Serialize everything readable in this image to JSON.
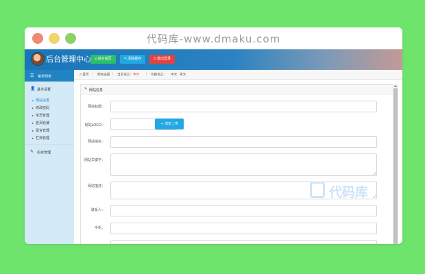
{
  "watermark_url": "代码库-www.dmaku.com",
  "header": {
    "title": "后台管理中心",
    "buttons": [
      {
        "icon": "home-icon",
        "label": "前台首页"
      },
      {
        "icon": "wrench-icon",
        "label": "清除缓存"
      },
      {
        "icon": "power-icon",
        "label": "退出登录"
      }
    ]
  },
  "sidebar": {
    "menu_title": "菜单列表",
    "groups": [
      {
        "label": "基本设置",
        "icon": "user-icon",
        "items": [
          "网站设置",
          "修改密码",
          "单页管理",
          "首页轮播",
          "留言管理",
          "栏目管理"
        ],
        "active_index": 0
      },
      {
        "label": "栏目管理",
        "icon": "edit-icon",
        "items": []
      }
    ]
  },
  "breadcrumb": {
    "home": "首页",
    "current": "网站设置",
    "current_lang_label": "当前语言：",
    "current_lang_value": "中文",
    "switch_label": "切换语言：",
    "switch_options": [
      "中文",
      "英文"
    ]
  },
  "panel": {
    "title": "网站信息",
    "fields": [
      {
        "label": "网站标题：",
        "value": ""
      },
      {
        "label": "网站LOGO：",
        "value": ""
      },
      {
        "label": "网站域名：",
        "value": ""
      },
      {
        "label": "网站关键字：",
        "value": ""
      },
      {
        "label": "网站描述：",
        "value": ""
      },
      {
        "label": "联系人：",
        "value": ""
      },
      {
        "label": "手机：",
        "value": ""
      }
    ],
    "upload_button": "+ 浏览上传"
  },
  "brand_watermark": "代码库",
  "colors": {
    "background": "#6ee46d",
    "header_blue": "#1a75b8",
    "green_button": "#2ebf6b",
    "blue_button": "#23a7e4",
    "red_button": "#e5413f",
    "sidebar_bg": "#d4eaf7",
    "active_link": "#2a8ad6"
  }
}
